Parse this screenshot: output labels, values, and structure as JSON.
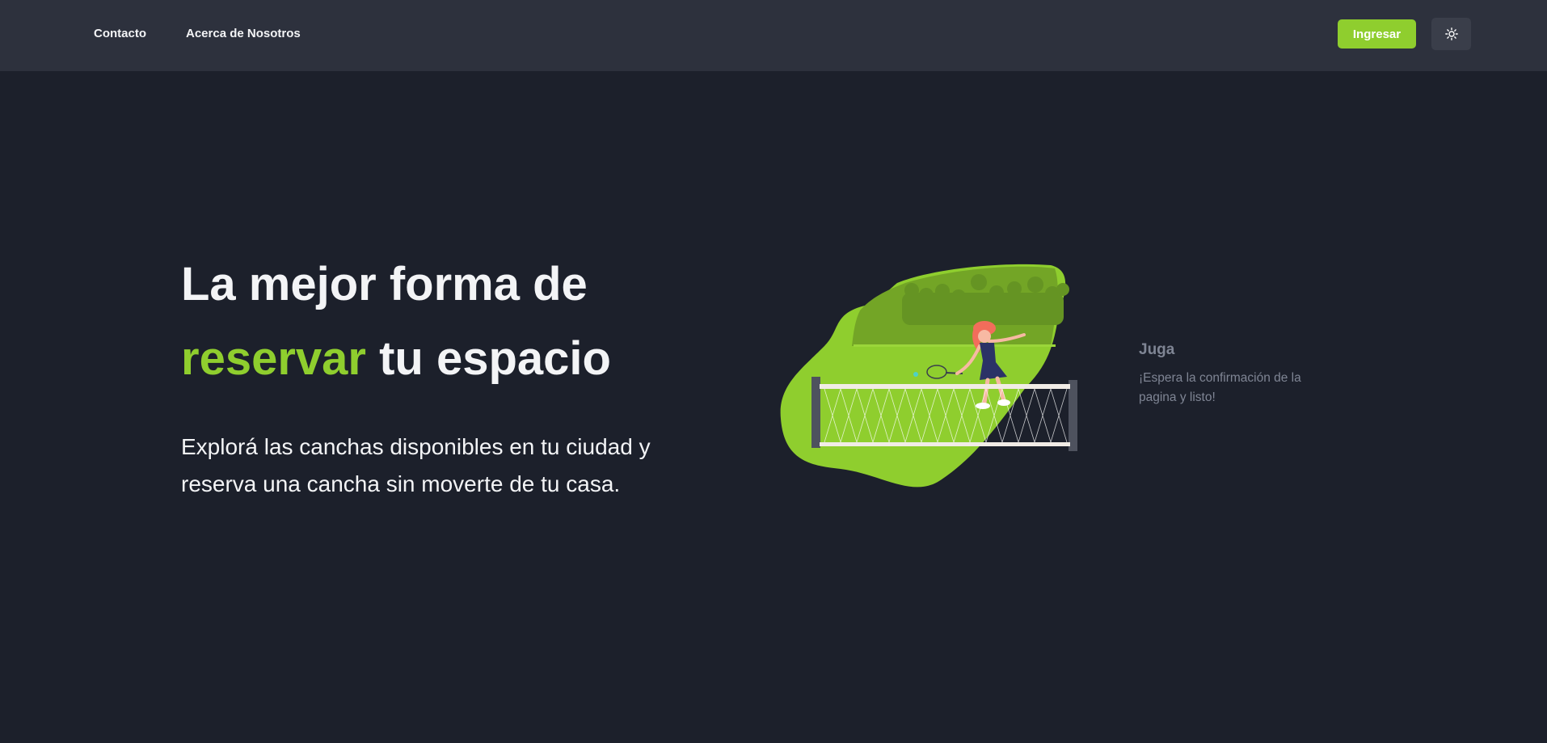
{
  "nav": {
    "links": [
      "Contacto",
      "Acerca de Nosotros"
    ],
    "login_label": "Ingresar",
    "theme_toggle_icon": "sun-icon"
  },
  "hero": {
    "title_line1": "La mejor forma de",
    "title_accent": "reservar",
    "title_rest": " tu espacio",
    "subtitle": "Explorá las canchas disponibles en tu ciudad y reserva una cancha sin moverte de tu casa."
  },
  "step": {
    "title": "Juga",
    "description": "¡Espera la confirmación de la pagina y listo!"
  },
  "colors": {
    "accent": "#8fce2e",
    "background": "#1c202b",
    "navbar": "#2d313d",
    "muted_text": "#7f8594"
  }
}
